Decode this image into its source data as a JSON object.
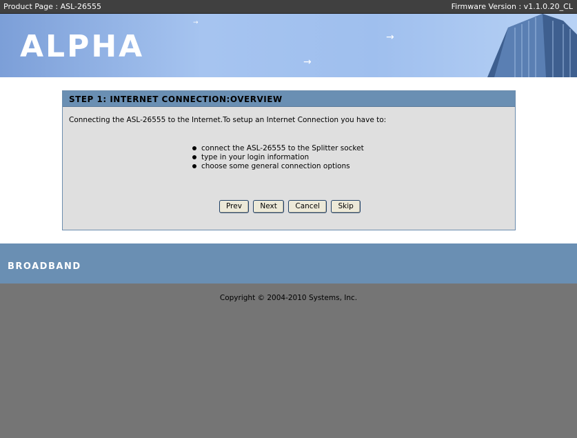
{
  "topbar": {
    "product_page": "Product Page : ASL-26555",
    "firmware": "Firmware Version : v1.1.0.20_CL"
  },
  "banner": {
    "logo": "ALPHA"
  },
  "wizard": {
    "title": "STEP 1: INTERNET CONNECTION:OVERVIEW",
    "intro": "Connecting the ASL-26555 to the Internet.To setup an Internet Connection you have to:",
    "steps": [
      "connect the ASL-26555 to the Splitter socket",
      "type in your login information",
      "choose some general connection options"
    ],
    "buttons": {
      "prev": "Prev",
      "next": "Next",
      "cancel": "Cancel",
      "skip": "Skip"
    }
  },
  "footer": {
    "brand": "BROADBAND",
    "copyright": "Copyright © 2004-2010 Systems, Inc."
  }
}
